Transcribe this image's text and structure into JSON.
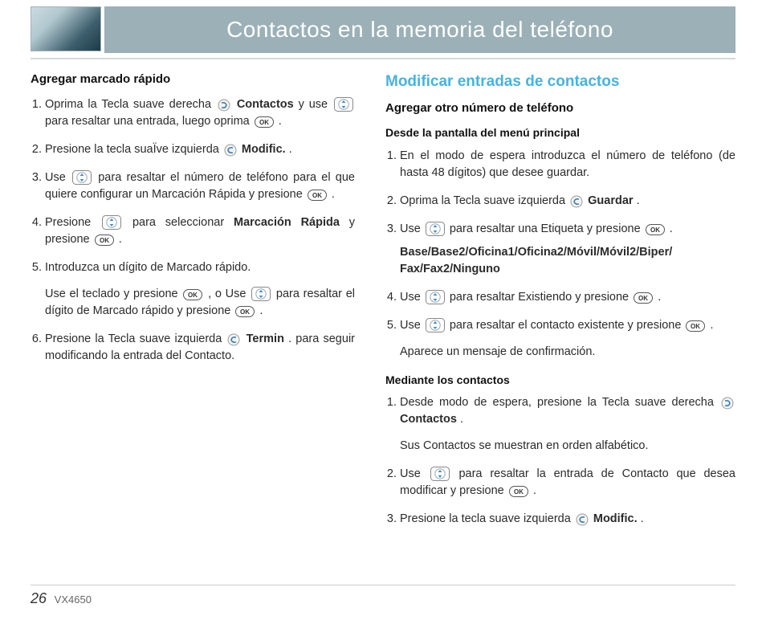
{
  "header": {
    "title": "Contactos en la memoria del teléfono"
  },
  "left": {
    "h3": "Agregar marcado rápido",
    "li1_a": "Oprima la Tecla suave derecha ",
    "li1_b": " Contactos",
    "li1_c": " y use ",
    "li1_d": " para resaltar una entrada, luego oprima ",
    "li1_e": ".",
    "li2_a": "Presione la tecla suaÏve izquierda ",
    "li2_b": " Modific.",
    "li2_c": ".",
    "li3_a": "Use ",
    "li3_b": " para resaltar el número de teléfono para el que quiere configurar un Marcación Rápida y presione ",
    "li3_c": ".",
    "li4_a": "Presione ",
    "li4_b": " para seleccionar ",
    "li4_c": "Marcación Rápida",
    "li4_d": " y presione ",
    "li4_e": ".",
    "li5_a": "Introduzca un dígito de Marcado rápido.",
    "li5_sub_a": "Use el teclado y presione ",
    "li5_sub_b": ", o Use ",
    "li5_sub_c": " para resaltar el dígito de Marcado rápido y presione ",
    "li5_sub_d": ".",
    "li6_a": "Presione la Tecla suave izquierda ",
    "li6_b": " Termin",
    "li6_c": ". para seguir modificando la entrada del Contacto."
  },
  "right": {
    "h2": "Modificar entradas de contactos",
    "h3": "Agregar otro número de teléfono",
    "h4a": "Desde la pantalla del menú principal",
    "a_li1": "En el modo de espera introduzca el número de teléfono (de hasta 48 dígitos) que desee guardar.",
    "a_li2_a": "Oprima la Tecla suave izquierda ",
    "a_li2_b": " Guardar",
    "a_li2_c": ".",
    "a_li3_a": "Use ",
    "a_li3_b": " para resaltar una Etiqueta y presione ",
    "a_li3_c": ".",
    "labels": "Base/Base2/Oficina1/Oficina2/Móvil/Móvil2/Biper/ Fax/Fax2/Ninguno",
    "a_li4_a": "Use ",
    "a_li4_b": " para resaltar Existiendo y presione ",
    "a_li4_c": ".",
    "a_li5_a": "Use ",
    "a_li5_b": " para resaltar el contacto existente y presione ",
    "a_li5_c": ".",
    "a_li5_d": "Aparece un mensaje de confirmación.",
    "h4b": "Mediante los contactos",
    "b_li1_a": "Desde modo de espera, presione la Tecla suave derecha ",
    "b_li1_b": " Contactos",
    "b_li1_c": ".",
    "b_li1_d": "Sus Contactos se muestran en orden alfabético.",
    "b_li2_a": "Use ",
    "b_li2_b": " para resaltar la entrada de Contacto que desea modificar y presione ",
    "b_li2_c": ".",
    "b_li3_a": "Presione la tecla suave izquierda ",
    "b_li3_b": " Modific.",
    "b_li3_c": "."
  },
  "footer": {
    "page": "26",
    "model": "VX4650"
  }
}
